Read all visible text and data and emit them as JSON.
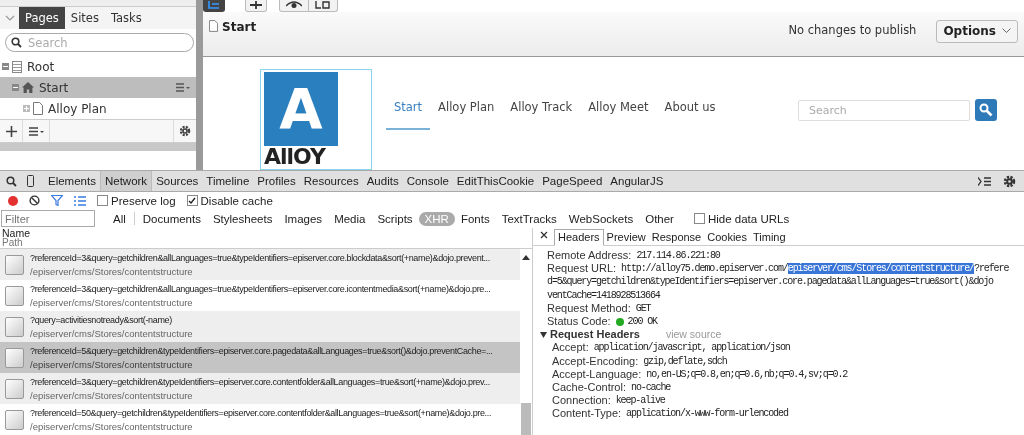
{
  "left_panel": {
    "tabs": [
      {
        "label": "Pages",
        "selected": true
      },
      {
        "label": "Sites",
        "selected": false
      },
      {
        "label": "Tasks",
        "selected": false
      }
    ],
    "search": {
      "placeholder": "Search"
    },
    "tree": [
      {
        "label": "Root",
        "kind": "root",
        "expanded": true,
        "selected": false,
        "children": [
          {
            "label": "Start",
            "kind": "home",
            "expanded": true,
            "selected": true,
            "children": [
              {
                "label": "Alloy Plan",
                "kind": "page",
                "expanded": false,
                "selected": false
              }
            ]
          }
        ]
      }
    ]
  },
  "editor": {
    "page_title": "Start",
    "publish_status": "No changes to publish",
    "options_button": "Options"
  },
  "preview": {
    "logo_letter": "A",
    "logo_text": "AllOY",
    "nav": [
      {
        "label": "Start",
        "selected": true
      },
      {
        "label": "Alloy Plan",
        "selected": false
      },
      {
        "label": "Alloy Track",
        "selected": false
      },
      {
        "label": "Alloy Meet",
        "selected": false
      },
      {
        "label": "About us",
        "selected": false
      }
    ],
    "search": {
      "placeholder": "Search"
    }
  },
  "devtools": {
    "tabs": [
      {
        "label": "Elements",
        "selected": false
      },
      {
        "label": "Network",
        "selected": true
      },
      {
        "label": "Sources",
        "selected": false
      },
      {
        "label": "Timeline",
        "selected": false
      },
      {
        "label": "Profiles",
        "selected": false
      },
      {
        "label": "Resources",
        "selected": false
      },
      {
        "label": "Audits",
        "selected": false
      },
      {
        "label": "Console",
        "selected": false
      },
      {
        "label": "EditThisCookie",
        "selected": false
      },
      {
        "label": "PageSpeed",
        "selected": false
      },
      {
        "label": "AngularJS",
        "selected": false
      }
    ],
    "recording": true,
    "preserve_log": {
      "label": "Preserve log",
      "checked": false
    },
    "disable_cache": {
      "label": "Disable cache",
      "checked": true
    },
    "filter": {
      "placeholder": "Filter"
    },
    "type_filters": [
      {
        "label": "All",
        "selected": false
      },
      {
        "label": "Documents",
        "selected": false
      },
      {
        "label": "Stylesheets",
        "selected": false
      },
      {
        "label": "Images",
        "selected": false
      },
      {
        "label": "Media",
        "selected": false
      },
      {
        "label": "Scripts",
        "selected": false
      },
      {
        "label": "XHR",
        "selected": true
      },
      {
        "label": "Fonts",
        "selected": false
      },
      {
        "label": "TextTracks",
        "selected": false
      },
      {
        "label": "WebSockets",
        "selected": false
      },
      {
        "label": "Other",
        "selected": false
      }
    ],
    "hide_data_urls": {
      "label": "Hide data URLs",
      "checked": false
    },
    "columns": {
      "name": "Name",
      "path": "Path"
    },
    "requests": [
      {
        "name": "?referenceId=3&query=getchildren&allLanguages=true&typeIdentifiers=episerver.core.blockdata&sort(+name)&dojo.prevent...",
        "path": "/episerver/cms/Stores/contentstructure",
        "selected": false
      },
      {
        "name": "?referenceId=3&query=getchildren&allLanguages=true&typeIdentifiers=episerver.core.icontentmedia&sort(+name)&dojo.pre...",
        "path": "/episerver/cms/Stores/contentstructure",
        "selected": false
      },
      {
        "name": "?query=activitiesnotready&sort(-name)",
        "path": "/episerver/cms/Stores/contentstructure",
        "selected": false
      },
      {
        "name": "?referenceId=5&query=getchildren&typeIdentifiers=episerver.core.pagedata&allLanguages=true&sort()&dojo.preventCache=...",
        "path": "/episerver/cms/Stores/contentstructure",
        "selected": true
      },
      {
        "name": "?referenceId=3&query=getchildren&typeIdentifiers=episerver.core.contentfolder&allLanguages=true&sort(+name)&dojo.prev...",
        "path": "/episerver/cms/Stores/contentstructure",
        "selected": false
      },
      {
        "name": "?referenceId=50&query=getchildren&typeIdentifiers=episerver.core.contentfolder&allLanguages=true&sort(+name)&dojo.pre...",
        "path": "/episerver/cms/Stores/contentstructure",
        "selected": false
      }
    ],
    "detail_tabs": [
      {
        "label": "Headers",
        "selected": true
      },
      {
        "label": "Preview",
        "selected": false
      },
      {
        "label": "Response",
        "selected": false
      },
      {
        "label": "Cookies",
        "selected": false
      },
      {
        "label": "Timing",
        "selected": false
      }
    ],
    "remote_address": {
      "label": "Remote Address:",
      "value": "217.114.86.221:80"
    },
    "request_url": {
      "label": "Request URL:",
      "parts": [
        {
          "text": "http://alloy75.demo.episerver.com/",
          "selected": false
        },
        {
          "text": "episerver/cms/Stores/contentstructure/",
          "selected": true
        },
        {
          "text": "?refere",
          "selected": false
        }
      ],
      "continuation": [
        "d=5&query=getchildren&typeIdentifiers=episerver.core.pagedata&allLanguages=true&sort()&dojo",
        "ventCache=1418928513664"
      ]
    },
    "request_method": {
      "label": "Request Method:",
      "value": "GET"
    },
    "status_code": {
      "label": "Status Code:",
      "value": "200 OK",
      "color": "#22aa22"
    },
    "request_headers": {
      "title": "Request Headers",
      "expanded": true,
      "view_source": "view source",
      "headers": [
        {
          "name": "Accept:",
          "value": "application/javascript, application/json"
        },
        {
          "name": "Accept-Encoding:",
          "value": "gzip,deflate,sdch"
        },
        {
          "name": "Accept-Language:",
          "value": "no,en-US;q=0.8,en;q=0.6,nb;q=0.4,sv;q=0.2"
        },
        {
          "name": "Cache-Control:",
          "value": "no-cache"
        },
        {
          "name": "Connection:",
          "value": "keep-alive"
        },
        {
          "name": "Content-Type:",
          "value": "application/x-www-form-urlencoded"
        }
      ]
    }
  }
}
